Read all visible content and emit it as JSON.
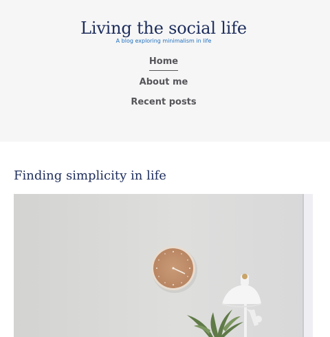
{
  "header": {
    "title": "Living the social life",
    "tagline": "A blog exploring minimalism in life"
  },
  "nav": {
    "items": [
      {
        "label": "Home",
        "active": true
      },
      {
        "label": "About me",
        "active": false
      },
      {
        "label": "Recent posts",
        "active": false
      }
    ]
  },
  "post": {
    "title": "Finding simplicity in life",
    "image_icon": "wall-clock-lamp-plant-photo"
  },
  "colors": {
    "header_bg": "#f6f6f6",
    "title": "#1d2d5c",
    "tagline": "#1f6fbf",
    "nav_text": "#55555a"
  }
}
